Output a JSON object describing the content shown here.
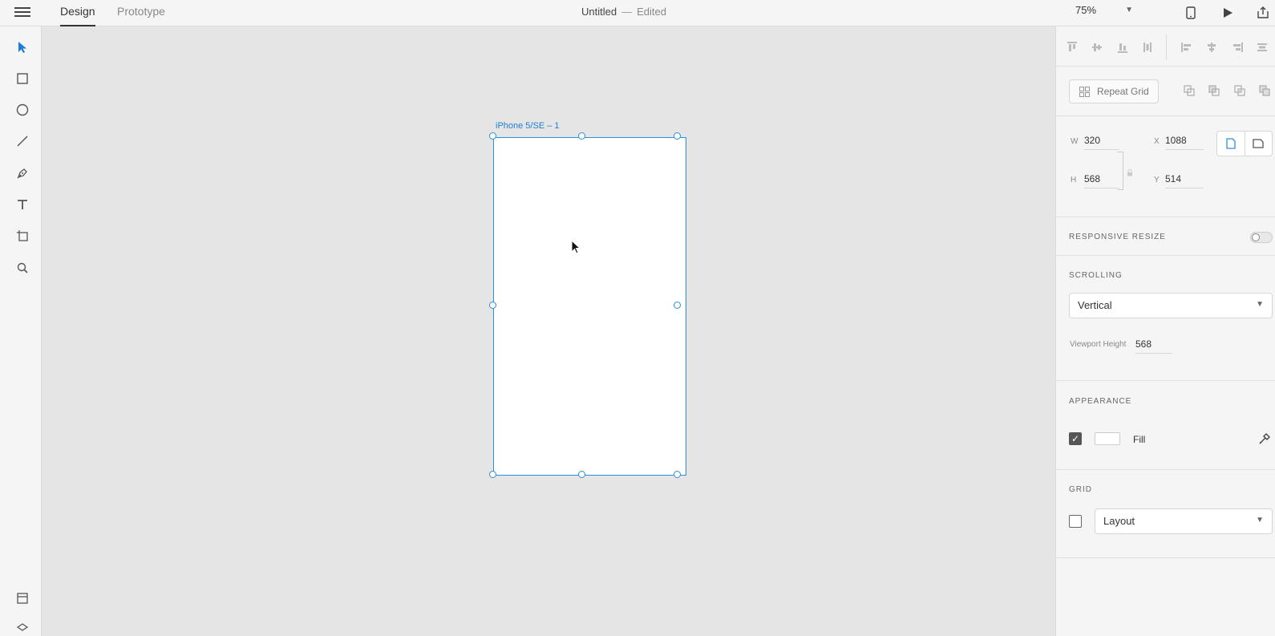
{
  "topbar": {
    "tabs": [
      {
        "label": "Design",
        "active": true
      },
      {
        "label": "Prototype",
        "active": false
      }
    ],
    "doc_title": "Untitled",
    "separator": "—",
    "doc_status": "Edited",
    "zoom": "75%"
  },
  "canvas": {
    "artboard_label": "iPhone 5/SE – 1"
  },
  "panel": {
    "repeat_grid_label": "Repeat Grid",
    "w_label": "W",
    "w_value": "320",
    "h_label": "H",
    "h_value": "568",
    "x_label": "X",
    "x_value": "1088",
    "y_label": "Y",
    "y_value": "514",
    "responsive_resize": "RESPONSIVE RESIZE",
    "scrolling": "SCROLLING",
    "scrolling_value": "Vertical",
    "viewport_height_label": "Viewport Height",
    "viewport_height_value": "568",
    "appearance": "APPEARANCE",
    "fill_label": "Fill",
    "fill_color": "#ffffff",
    "grid": "GRID",
    "grid_value": "Layout"
  },
  "colors": {
    "accent": "#2d8fe0",
    "canvas": "#e5e5e5",
    "panel": "#f5f5f5"
  }
}
